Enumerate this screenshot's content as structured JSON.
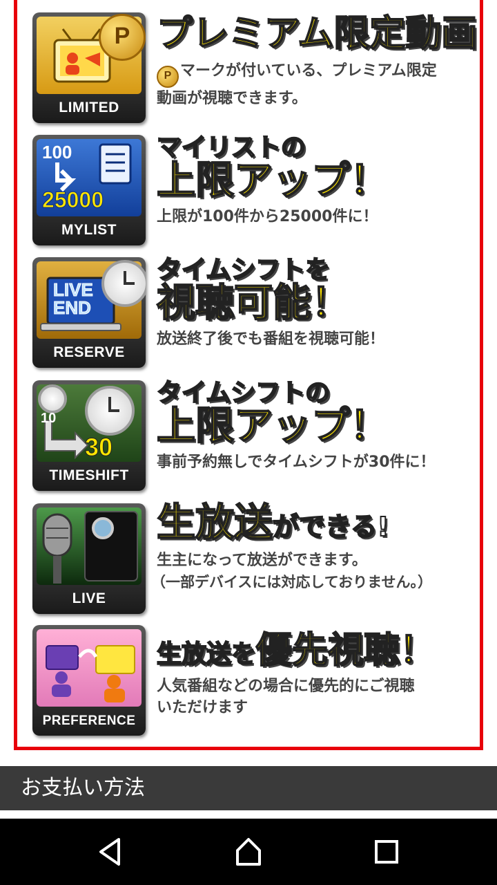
{
  "features": [
    {
      "id": "limited",
      "caption": "LIMITED",
      "headline": [
        "プレミアム限定動画"
      ],
      "description": [
        "マークが付いている、プレミアム限定",
        "動画が視聴できます。"
      ],
      "coin_letter": "P"
    },
    {
      "id": "mylist",
      "caption": "MYLIST",
      "headline": [
        "マイリストの",
        "上限アップ！"
      ],
      "description": [
        "上限が100件から25000件に！"
      ],
      "art_top": "100",
      "art_bottom": "25000"
    },
    {
      "id": "reserve",
      "caption": "RESERVE",
      "headline": [
        "タイムシフトを",
        "視聴可能！"
      ],
      "description": [
        "放送終了後でも番組を視聴可能！"
      ],
      "art_top": "LIVE",
      "art_bottom": "END"
    },
    {
      "id": "timeshift",
      "caption": "TIMESHIFT",
      "headline": [
        "タイムシフトの",
        "上限アップ！"
      ],
      "description": [
        "事前予約無しでタイムシフトが30件に！"
      ],
      "art_top": "10",
      "art_bottom": "30"
    },
    {
      "id": "live",
      "caption": "LIVE",
      "headline": [
        "生放送",
        "ができる!"
      ],
      "description": [
        "生主になって放送ができます。",
        "（一部デバイスには対応しておりません。）"
      ]
    },
    {
      "id": "preference",
      "caption": "PREFERENCE",
      "headline": [
        "生放送を",
        "優先視聴！"
      ],
      "description": [
        "人気番組などの場合に優先的にご視聴",
        "いただけます"
      ]
    }
  ],
  "section": {
    "title": "お支払い方法"
  },
  "colors": {
    "frame": "#e8000b",
    "headline_yellow": "#ffe600",
    "section_bar": "#3a3a3a"
  },
  "nav": {
    "back_icon": "back-triangle-icon",
    "home_icon": "home-icon",
    "recents_icon": "recents-square-icon"
  }
}
